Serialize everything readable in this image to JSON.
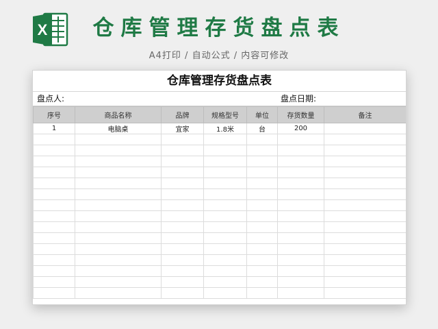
{
  "banner": {
    "title": "仓库管理存货盘点表",
    "subtitle": "A4打印 / 自动公式 / 内容可修改",
    "logo_letter": "X",
    "accent_color": "#1f7a45",
    "logo_icon": "excel-icon"
  },
  "sheet": {
    "title": "仓库管理存货盘点表",
    "counter_label": "盘点人:",
    "date_label": "盘点日期:",
    "columns": [
      "序号",
      "商品名称",
      "品牌",
      "规格型号",
      "单位",
      "存货数量",
      "备注"
    ],
    "rows": [
      [
        "1",
        "电脑桌",
        "宜家",
        "1.8米",
        "台",
        "200",
        ""
      ],
      [
        "",
        "",
        "",
        "",
        "",
        "",
        ""
      ],
      [
        "",
        "",
        "",
        "",
        "",
        "",
        ""
      ],
      [
        "",
        "",
        "",
        "",
        "",
        "",
        ""
      ],
      [
        "",
        "",
        "",
        "",
        "",
        "",
        ""
      ],
      [
        "",
        "",
        "",
        "",
        "",
        "",
        ""
      ],
      [
        "",
        "",
        "",
        "",
        "",
        "",
        ""
      ],
      [
        "",
        "",
        "",
        "",
        "",
        "",
        ""
      ],
      [
        "",
        "",
        "",
        "",
        "",
        "",
        ""
      ],
      [
        "",
        "",
        "",
        "",
        "",
        "",
        ""
      ],
      [
        "",
        "",
        "",
        "",
        "",
        "",
        ""
      ],
      [
        "",
        "",
        "",
        "",
        "",
        "",
        ""
      ],
      [
        "",
        "",
        "",
        "",
        "",
        "",
        ""
      ],
      [
        "",
        "",
        "",
        "",
        "",
        "",
        ""
      ],
      [
        "",
        "",
        "",
        "",
        "",
        "",
        ""
      ],
      [
        "",
        "",
        "",
        "",
        "",
        "",
        ""
      ]
    ]
  }
}
